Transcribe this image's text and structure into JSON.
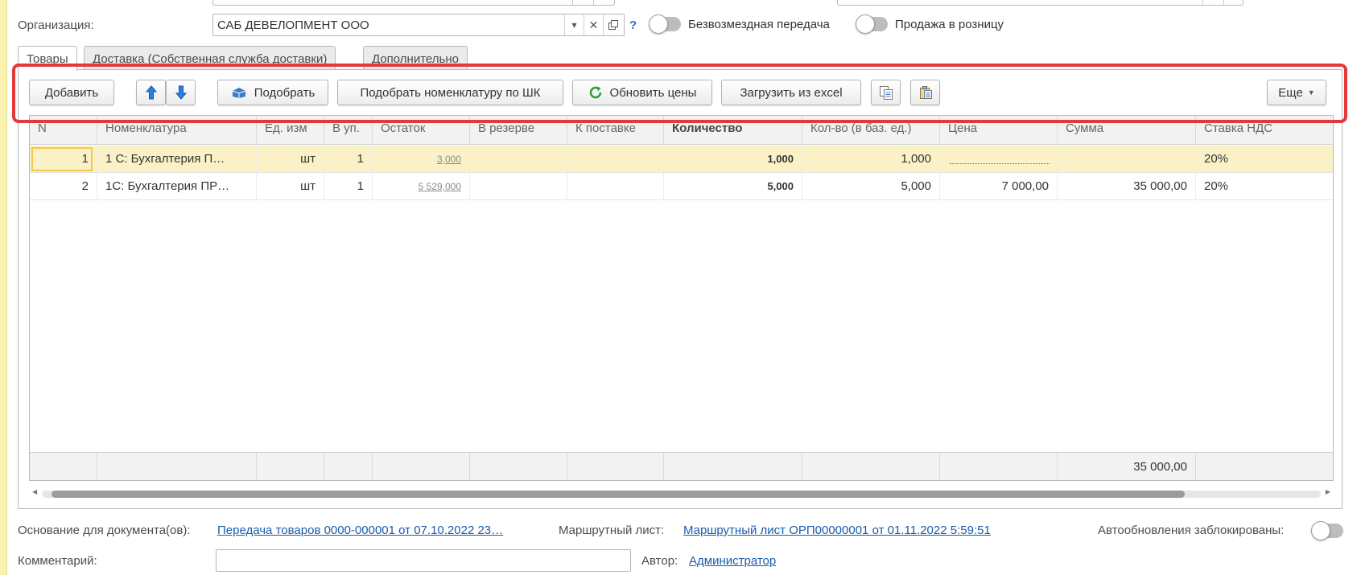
{
  "organization": {
    "label": "Организация:",
    "value": "САБ ДЕВЕЛОПМЕНТ ООО",
    "help": "?",
    "toggle_free_transfer_label": "Безвозмездная передача",
    "toggle_retail_label": "Продажа в розницу"
  },
  "tabs": [
    {
      "label": "Товары",
      "active": true
    },
    {
      "label": "Доставка (Собственная служба доставки)",
      "active": false
    },
    {
      "label": "Дополнительно",
      "active": false
    }
  ],
  "toolbar": {
    "add": "Добавить",
    "pick": "Подобрать",
    "pick_barcode": "Подобрать номенклатуру по ШК",
    "update_prices": "Обновить цены",
    "load_excel": "Загрузить из excel",
    "more": "Еще"
  },
  "table": {
    "columns": [
      "N",
      "Номенклатура",
      "Ед. изм",
      "В уп.",
      "Остаток",
      "В резерве",
      "К поставке",
      "Количество",
      "Кол-во (в баз. ед.)",
      "Цена",
      "Сумма",
      "Ставка НДС"
    ],
    "rows": [
      {
        "n": "1",
        "item": "1 С:  Бухгалтерия П…",
        "unit": "шт",
        "pack": "1",
        "stock": "3,000",
        "reserve": "",
        "to_supply": "",
        "qty": "1,000",
        "qty_base": "1,000",
        "price": "",
        "sum": "",
        "vat": "20%"
      },
      {
        "n": "2",
        "item": "1С: Бухгалтерия ПР…",
        "unit": "шт",
        "pack": "1",
        "stock": "5 529,000",
        "reserve": "",
        "to_supply": "",
        "qty": "5,000",
        "qty_base": "5,000",
        "price": "7 000,00",
        "sum": "35 000,00",
        "vat": "20%"
      }
    ],
    "total_sum": "35 000,00"
  },
  "bottom": {
    "basis_label": "Основание для документа(ов):",
    "basis_link": "Передача товаров 0000-000001 от 07.10.2022 23…",
    "route_label": "Маршрутный лист:",
    "route_link": "Маршрутный лист ОРП00000001 от 01.11.2022 5:59:51",
    "autoupdate_label": "Автообновления заблокированы:",
    "comment_label": "Комментарий:",
    "comment_value": "",
    "author_label": "Автор:",
    "author_link": "Администратор"
  },
  "colors": {
    "highlight_box": "#e23a3a",
    "selected_row": "#fbf1c7",
    "link": "#1a5ca8",
    "accent_green": "#2ea043",
    "accent_blue": "#1c6fd1"
  }
}
